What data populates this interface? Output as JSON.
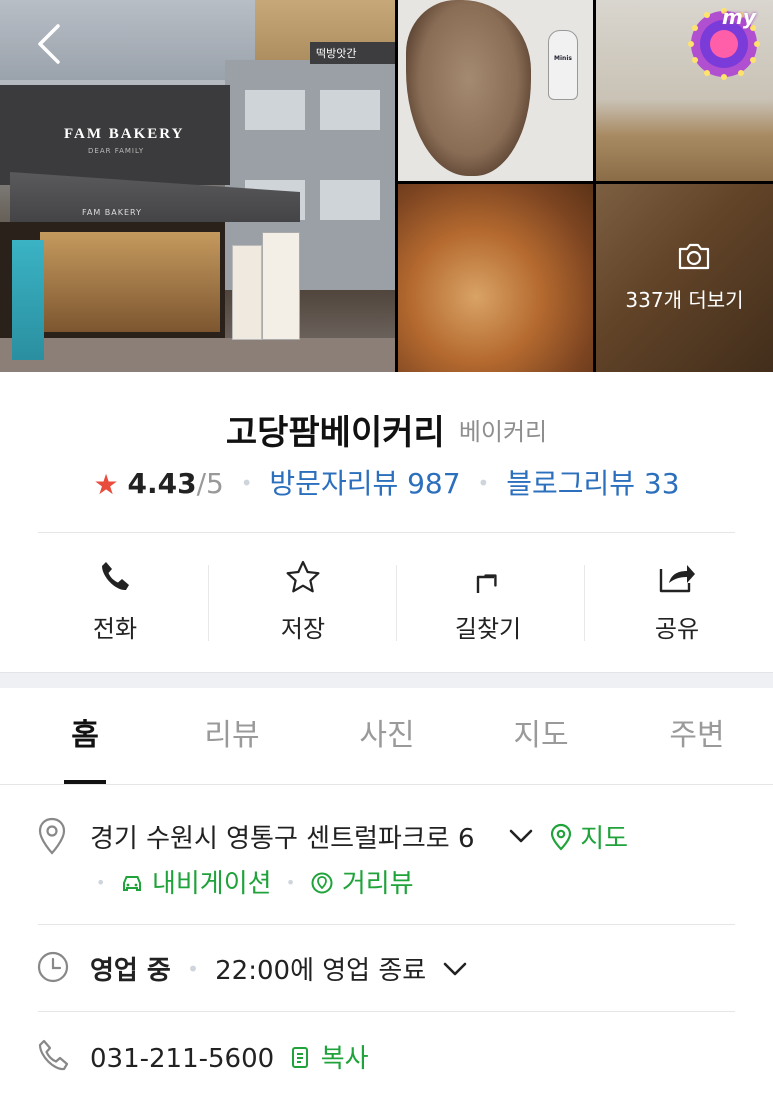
{
  "photos": {
    "storefront": {
      "sign": "FAM BAKERY",
      "sign_sub": "DEAR FAMILY",
      "awning": "FAM BAKERY"
    },
    "bread": {
      "bottle_label": "Minis"
    },
    "badge": "my",
    "more_label": "337개 더보기"
  },
  "place": {
    "name": "고당팜베이커리",
    "category": "베이커리",
    "rating": "4.43",
    "rating_max": "/5",
    "visitor_reviews": "방문자리뷰 987",
    "blog_reviews": "블로그리뷰 33"
  },
  "actions": [
    {
      "label": "전화",
      "icon": "phone-icon"
    },
    {
      "label": "저장",
      "icon": "star-outline-icon"
    },
    {
      "label": "길찾기",
      "icon": "directions-icon"
    },
    {
      "label": "공유",
      "icon": "share-icon"
    }
  ],
  "tabs": [
    {
      "label": "홈",
      "active": true
    },
    {
      "label": "리뷰"
    },
    {
      "label": "사진"
    },
    {
      "label": "지도"
    },
    {
      "label": "주변"
    }
  ],
  "info": {
    "address": "경기 수원시 영통구 센트럴파크로 6",
    "map_link": "지도",
    "navigation": "내비게이션",
    "street_view": "거리뷰",
    "hours_status": "영업 중",
    "hours_detail": "22:00에 영업 종료",
    "phone": "031-211-5600",
    "copy": "복사"
  },
  "colors": {
    "accent_green": "#1fa33a",
    "link_blue": "#2c6fbd",
    "star_red": "#e74c3c"
  }
}
